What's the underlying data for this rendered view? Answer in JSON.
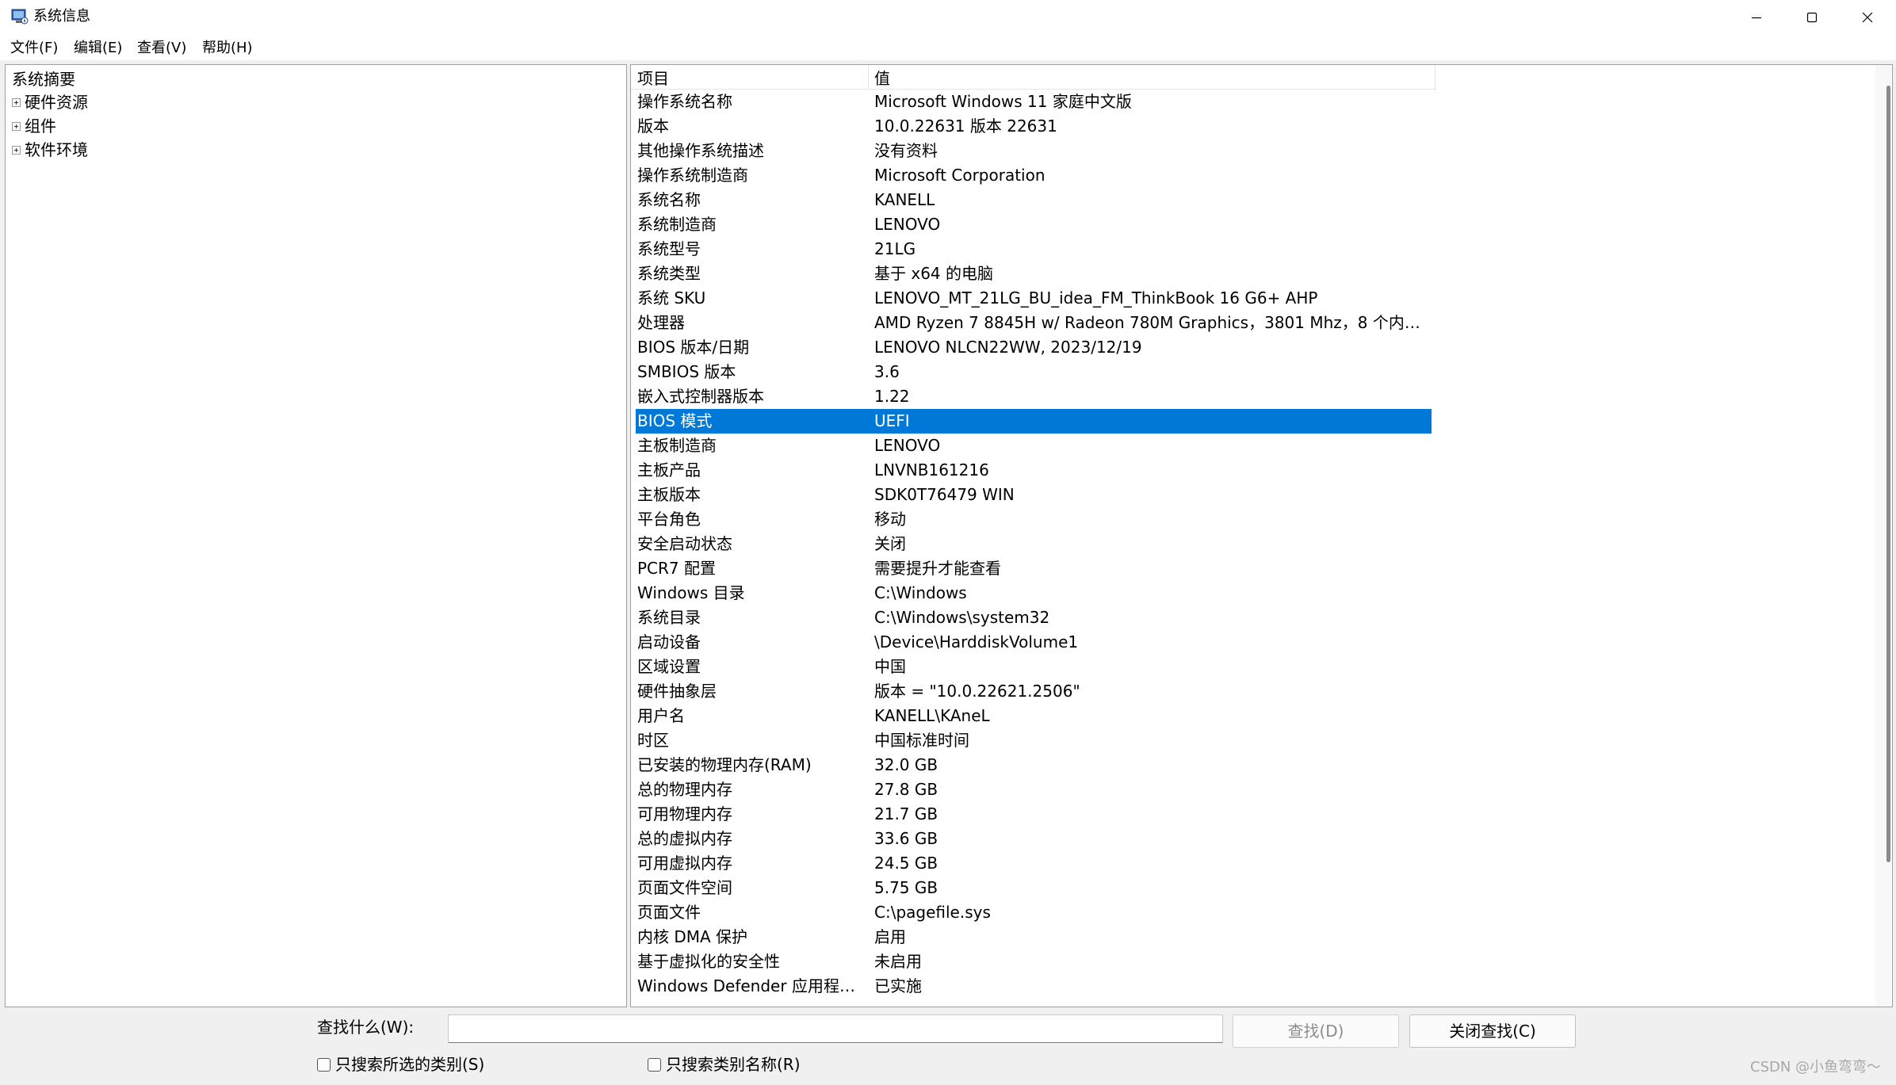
{
  "window": {
    "title": "系统信息"
  },
  "menu": [
    "文件(F)",
    "编辑(E)",
    "查看(V)",
    "帮助(H)"
  ],
  "tree": {
    "root": "系统摘要",
    "nodes": [
      "硬件资源",
      "组件",
      "软件环境"
    ]
  },
  "list": {
    "columns": [
      "项目",
      "值"
    ],
    "selected_row": "BIOS 模式",
    "rows": [
      [
        "操作系统名称",
        "Microsoft Windows 11 家庭中文版"
      ],
      [
        "版本",
        "10.0.22631 版本 22631"
      ],
      [
        "其他操作系统描述",
        "没有资料"
      ],
      [
        "操作系统制造商",
        "Microsoft Corporation"
      ],
      [
        "系统名称",
        "KANELL"
      ],
      [
        "系统制造商",
        "LENOVO"
      ],
      [
        "系统型号",
        "21LG"
      ],
      [
        "系统类型",
        "基于 x64 的电脑"
      ],
      [
        "系统 SKU",
        "LENOVO_MT_21LG_BU_idea_FM_ThinkBook 16 G6+ AHP"
      ],
      [
        "处理器",
        "AMD Ryzen 7 8845H w/ Radeon 780M Graphics，3801 Mhz，8 个内核..."
      ],
      [
        "BIOS 版本/日期",
        "LENOVO NLCN22WW, 2023/12/19"
      ],
      [
        "SMBIOS 版本",
        "3.6"
      ],
      [
        "嵌入式控制器版本",
        "1.22"
      ],
      [
        "BIOS 模式",
        "UEFI"
      ],
      [
        "主板制造商",
        "LENOVO"
      ],
      [
        "主板产品",
        "LNVNB161216"
      ],
      [
        "主板版本",
        "SDK0T76479 WIN"
      ],
      [
        "平台角色",
        "移动"
      ],
      [
        "安全启动状态",
        "关闭"
      ],
      [
        "PCR7 配置",
        "需要提升才能查看"
      ],
      [
        "Windows 目录",
        "C:\\Windows"
      ],
      [
        "系统目录",
        "C:\\Windows\\system32"
      ],
      [
        "启动设备",
        "\\Device\\HarddiskVolume1"
      ],
      [
        "区域设置",
        "中国"
      ],
      [
        "硬件抽象层",
        "版本 = \"10.0.22621.2506\""
      ],
      [
        "用户名",
        "KANELL\\KAneL"
      ],
      [
        "时区",
        "中国标准时间"
      ],
      [
        "已安装的物理内存(RAM)",
        "32.0 GB"
      ],
      [
        "总的物理内存",
        "27.8 GB"
      ],
      [
        "可用物理内存",
        "21.7 GB"
      ],
      [
        "总的虚拟内存",
        "33.6 GB"
      ],
      [
        "可用虚拟内存",
        "24.5 GB"
      ],
      [
        "页面文件空间",
        "5.75 GB"
      ],
      [
        "页面文件",
        "C:\\pagefile.sys"
      ],
      [
        "内核 DMA 保护",
        "启用"
      ],
      [
        "基于虚拟化的安全性",
        "未启用"
      ],
      [
        "Windows Defender 应用程序...",
        "已实施"
      ]
    ]
  },
  "find": {
    "label": "查找什么(W):",
    "value": "",
    "find_button": "查找(D)",
    "close_button": "关闭查找(C)",
    "option_selected_category": "只搜索所选的类别(S)",
    "option_category_names": "只搜索类别名称(R)"
  },
  "watermark": "CSDN @小鱼弯弯～",
  "colors": {
    "selection": "#0078d7",
    "pane_border": "#a0a0a0"
  }
}
